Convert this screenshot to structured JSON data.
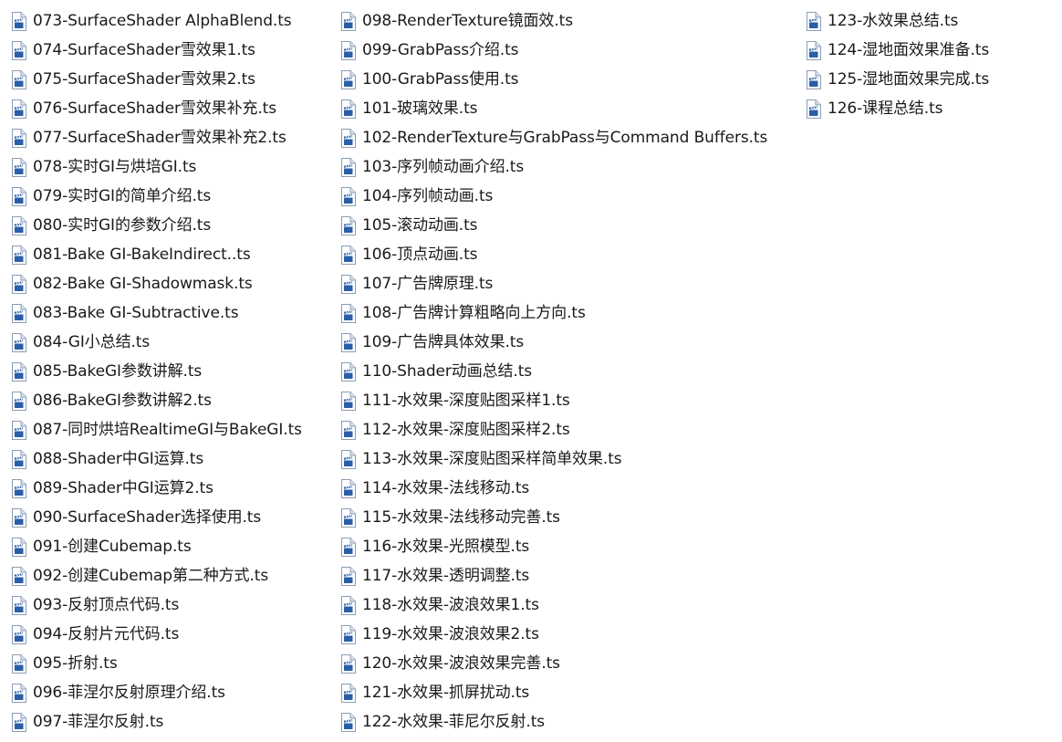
{
  "explorer": {
    "columns": [
      {
        "items": [
          {
            "name": "073-SurfaceShader AlphaBlend.ts"
          },
          {
            "name": "074-SurfaceShader雪效果1.ts"
          },
          {
            "name": "075-SurfaceShader雪效果2.ts"
          },
          {
            "name": "076-SurfaceShader雪效果补充.ts"
          },
          {
            "name": "077-SurfaceShader雪效果补充2.ts"
          },
          {
            "name": "078-实时GI与烘培GI.ts"
          },
          {
            "name": "079-实时GI的简单介绍.ts"
          },
          {
            "name": "080-实时GI的参数介绍.ts"
          },
          {
            "name": "081-Bake GI-BakeIndirect..ts"
          },
          {
            "name": "082-Bake GI-Shadowmask.ts"
          },
          {
            "name": "083-Bake GI-Subtractive.ts"
          },
          {
            "name": "084-GI小总结.ts"
          },
          {
            "name": "085-BakeGI参数讲解.ts"
          },
          {
            "name": "086-BakeGI参数讲解2.ts"
          },
          {
            "name": "087-同时烘培RealtimeGI与BakeGI.ts"
          },
          {
            "name": "088-Shader中GI运算.ts"
          },
          {
            "name": "089-Shader中GI运算2.ts"
          },
          {
            "name": "090-SurfaceShader选择使用.ts"
          },
          {
            "name": "091-创建Cubemap.ts"
          },
          {
            "name": "092-创建Cubemap第二种方式.ts"
          },
          {
            "name": "093-反射顶点代码.ts"
          },
          {
            "name": "094-反射片元代码.ts"
          },
          {
            "name": "095-折射.ts"
          },
          {
            "name": "096-菲涅尔反射原理介绍.ts"
          },
          {
            "name": "097-菲涅尔反射.ts"
          }
        ]
      },
      {
        "items": [
          {
            "name": "098-RenderTexture镜面效.ts"
          },
          {
            "name": "099-GrabPass介绍.ts"
          },
          {
            "name": "100-GrabPass使用.ts"
          },
          {
            "name": "101-玻璃效果.ts"
          },
          {
            "name": "102-RenderTexture与GrabPass与Command Buffers.ts"
          },
          {
            "name": "103-序列帧动画介绍.ts"
          },
          {
            "name": "104-序列帧动画.ts"
          },
          {
            "name": "105-滚动动画.ts"
          },
          {
            "name": "106-顶点动画.ts"
          },
          {
            "name": "107-广告牌原理.ts"
          },
          {
            "name": "108-广告牌计算粗略向上方向.ts"
          },
          {
            "name": "109-广告牌具体效果.ts"
          },
          {
            "name": "110-Shader动画总结.ts"
          },
          {
            "name": "111-水效果-深度贴图采样1.ts"
          },
          {
            "name": "112-水效果-深度贴图采样2.ts"
          },
          {
            "name": "113-水效果-深度贴图采样简单效果.ts"
          },
          {
            "name": "114-水效果-法线移动.ts"
          },
          {
            "name": "115-水效果-法线移动完善.ts"
          },
          {
            "name": "116-水效果-光照模型.ts"
          },
          {
            "name": "117-水效果-透明调整.ts"
          },
          {
            "name": "118-水效果-波浪效果1.ts"
          },
          {
            "name": "119-水效果-波浪效果2.ts"
          },
          {
            "name": "120-水效果-波浪效果完善.ts"
          },
          {
            "name": "121-水效果-抓屏扰动.ts"
          },
          {
            "name": "122-水效果-菲尼尔反射.ts"
          }
        ]
      },
      {
        "items": [
          {
            "name": "123-水效果总结.ts"
          },
          {
            "name": "124-湿地面效果准备.ts"
          },
          {
            "name": "125-湿地面效果完成.ts"
          },
          {
            "name": "126-课程总结.ts"
          }
        ]
      }
    ],
    "file_icon": "video-file-icon",
    "colors": {
      "icon_page": "#ffffff",
      "icon_border": "#8a9db5",
      "icon_fold": "#dbe4ef",
      "icon_clapper": "#2a5ea8",
      "text": "#1a1a1a"
    }
  }
}
